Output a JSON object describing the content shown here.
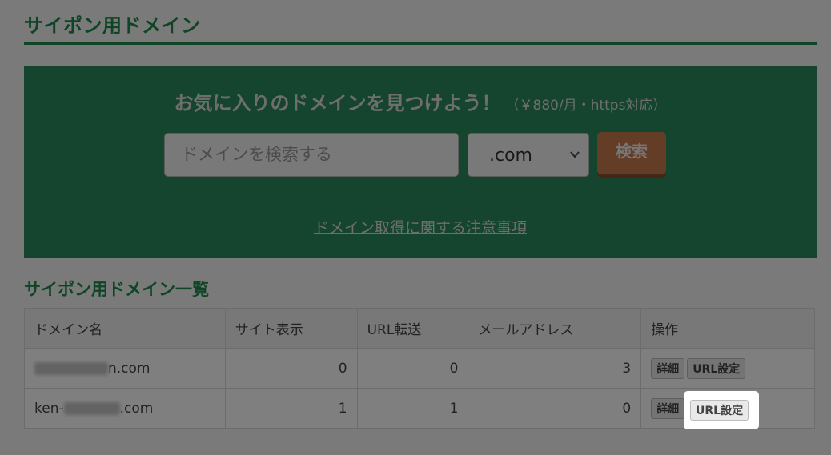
{
  "header": {
    "title": "サイポン用ドメイン"
  },
  "search": {
    "headline_main": "お気に入りのドメインを見つけよう！",
    "headline_sub": "（￥880/月・https対応）",
    "placeholder": "ドメインを検索する",
    "tld_selected": ".com",
    "button_label": "検索",
    "notice_link": "ドメイン取得に関する注意事項"
  },
  "list": {
    "title": "サイポン用ドメイン一覧",
    "columns": [
      "ドメイン名",
      "サイト表示",
      "URL転送",
      "メールアドレス",
      "操作"
    ],
    "rows": [
      {
        "domain_prefix": "",
        "domain_suffix": "n.com",
        "site_display": "0",
        "url_forward": "0",
        "mail": "3",
        "detail_label": "詳細",
        "url_setting_label": "URL設定"
      },
      {
        "domain_prefix": "ken-",
        "domain_suffix": ".com",
        "site_display": "1",
        "url_forward": "1",
        "mail": "0",
        "detail_label": "詳細",
        "url_setting_label": "URL設定"
      }
    ]
  },
  "colors": {
    "brand_green": "#1e8a4c",
    "search_button": "#c97a4d"
  },
  "icons": {
    "select_arrow": "chevron-down-icon"
  }
}
